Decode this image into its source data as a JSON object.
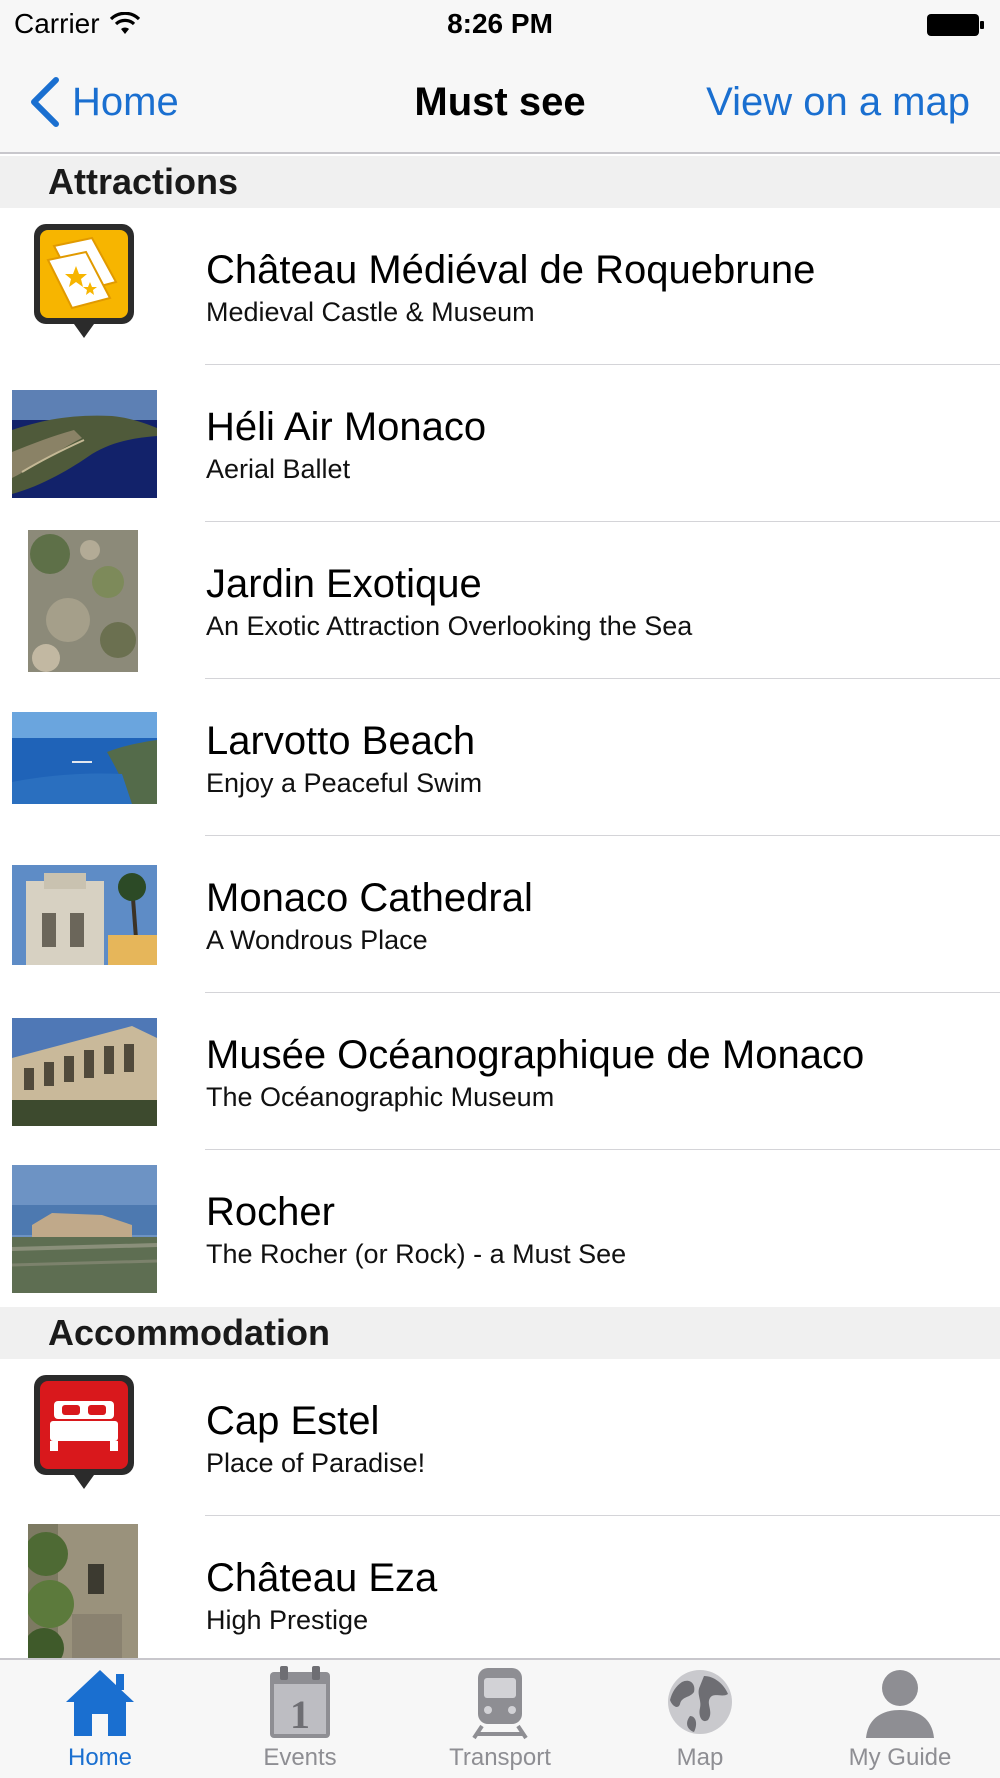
{
  "status_bar": {
    "carrier": "Carrier",
    "time": "8:26 PM"
  },
  "nav": {
    "back_label": "Home",
    "title": "Must see",
    "right_label": "View on a map"
  },
  "sections": [
    {
      "title": "Attractions",
      "items": [
        {
          "title": "Château Médiéval de Roquebrune",
          "subtitle": "Medieval Castle & Museum",
          "thumb": "ticket-pin-icon"
        },
        {
          "title": "Héli Air Monaco",
          "subtitle": "Aerial Ballet",
          "thumb": "aerial-coast-photo"
        },
        {
          "title": "Jardin Exotique",
          "subtitle": "An Exotic Attraction Overlooking the Sea",
          "thumb": "exotic-garden-photo"
        },
        {
          "title": "Larvotto Beach",
          "subtitle": "Enjoy a Peaceful Swim",
          "thumb": "beach-photo"
        },
        {
          "title": "Monaco Cathedral",
          "subtitle": "A Wondrous Place",
          "thumb": "cathedral-photo"
        },
        {
          "title": "Musée Océanographique de Monaco",
          "subtitle": "The Océanographic Museum",
          "thumb": "museum-photo"
        },
        {
          "title": "Rocher",
          "subtitle": "The Rocher (or Rock) - a Must See",
          "thumb": "rocher-photo"
        }
      ]
    },
    {
      "title": "Accommodation",
      "items": [
        {
          "title": "Cap Estel",
          "subtitle": "Place of Paradise!",
          "thumb": "bed-pin-icon"
        },
        {
          "title": "Château Eza",
          "subtitle": "High Prestige",
          "thumb": "chateau-eza-photo"
        }
      ]
    }
  ],
  "tabs": [
    {
      "label": "Home",
      "icon": "home-icon",
      "active": true
    },
    {
      "label": "Events",
      "icon": "calendar-icon",
      "active": false
    },
    {
      "label": "Transport",
      "icon": "train-icon",
      "active": false
    },
    {
      "label": "Map",
      "icon": "globe-icon",
      "active": false
    },
    {
      "label": "My Guide",
      "icon": "person-icon",
      "active": false
    }
  ],
  "colors": {
    "accent": "#1a6fd0",
    "attraction_pin": "#f7b500",
    "accommodation_pin": "#d9181c"
  }
}
